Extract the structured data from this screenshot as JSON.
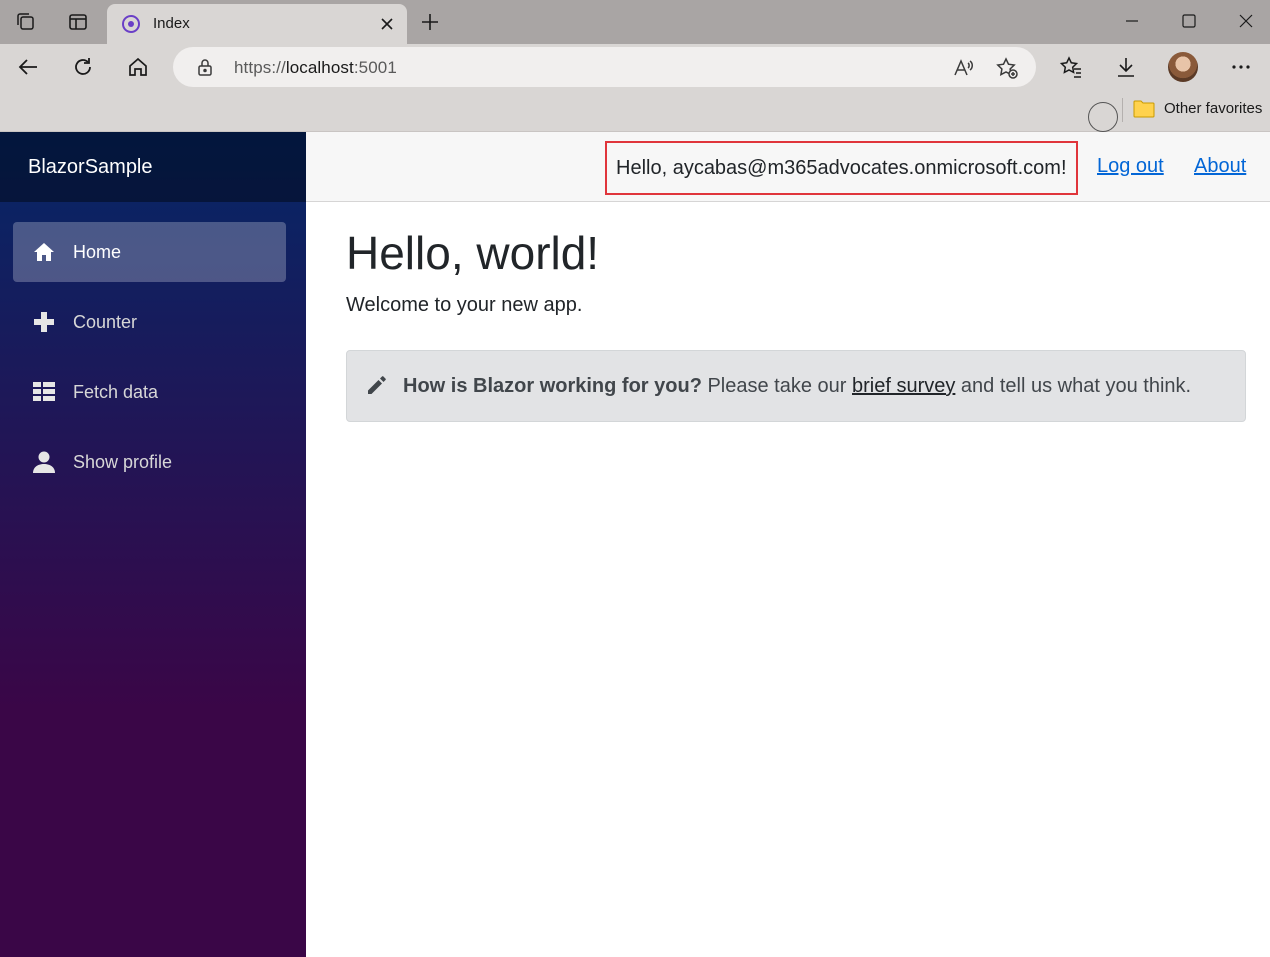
{
  "browser": {
    "tab_title": "Index",
    "address_prefix": "https://",
    "address_host": "localhost",
    "address_port": ":5001",
    "favorites_label": "Other favorites"
  },
  "app": {
    "brand": "BlazorSample",
    "nav": [
      {
        "label": "Home",
        "icon": "home-icon",
        "active": true
      },
      {
        "label": "Counter",
        "icon": "plus-icon",
        "active": false
      },
      {
        "label": "Fetch data",
        "icon": "list-icon",
        "active": false
      },
      {
        "label": "Show profile",
        "icon": "person-icon",
        "active": false
      }
    ],
    "top": {
      "greeting": "Hello, aycabas@m365advocates.onmicrosoft.com!",
      "logout": "Log out",
      "about": "About"
    },
    "content": {
      "title": "Hello, world!",
      "welcome": "Welcome to your new app.",
      "survey_question": "How is Blazor working for you?",
      "survey_pre": " Please take our ",
      "survey_link": "brief survey",
      "survey_post": " and tell us what you think."
    }
  },
  "colors": {
    "sidebar_top": "#052767",
    "sidebar_bottom": "#3a0647",
    "link": "#0366d6",
    "highlight_border": "#e0353b"
  }
}
